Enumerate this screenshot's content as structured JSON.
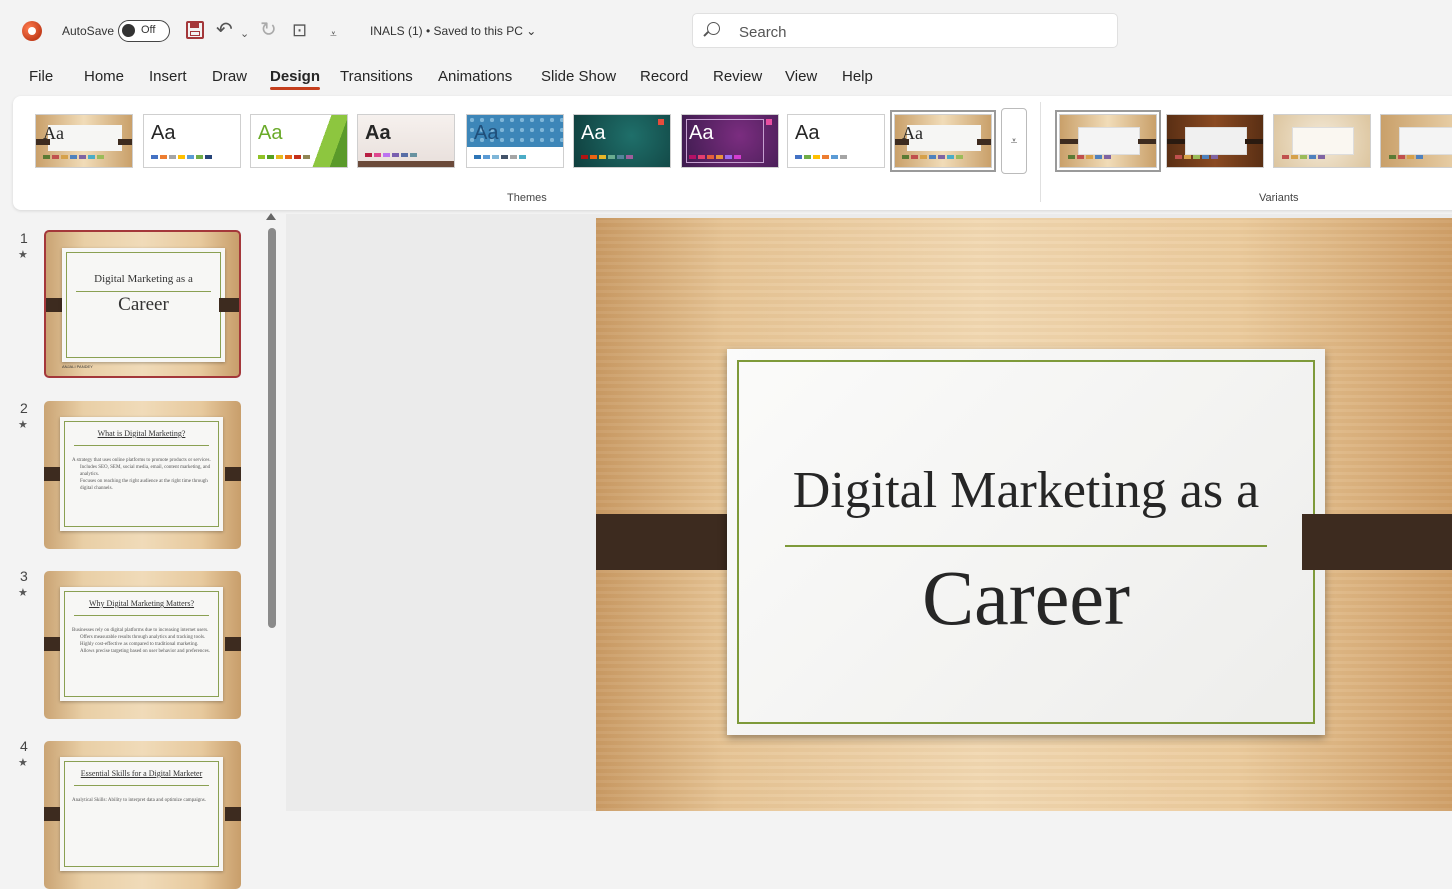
{
  "titlebar": {
    "autosave_label": "AutoSave",
    "autosave_state": "Off",
    "doc_title": "INALS (1) • Saved to this PC ⌄",
    "search_placeholder": "Search"
  },
  "menu": [
    "File",
    "Home",
    "Insert",
    "Draw",
    "Design",
    "Transitions",
    "Animations",
    "Slide Show",
    "Record",
    "Review",
    "View",
    "Help"
  ],
  "active_tab": "Design",
  "ribbon": {
    "themes_label": "Themes",
    "variants_label": "Variants",
    "theme_aa": "Aa"
  },
  "slides": [
    {
      "num": "1",
      "title": "Digital Marketing as a",
      "subtitle": "Career",
      "footer": "ANJALI PANDEY"
    },
    {
      "num": "2",
      "title": "What is Digital Marketing?",
      "bullets": [
        "A strategy that uses online platforms to promote products or services.",
        "Includes SEO, SEM, social media, email, content marketing, and analytics.",
        "Focuses on reaching the right audience at the right time through digital channels."
      ]
    },
    {
      "num": "3",
      "title": "Why Digital Marketing Matters?",
      "bullets": [
        "Businesses rely on digital platforms due to increasing internet users.",
        "Offers measurable results through analytics and tracking tools.",
        "Highly cost-effective as compared to traditional marketing.",
        "Allows precise targeting based on user behavior and preferences."
      ]
    },
    {
      "num": "4",
      "title": "Essential Skills for a Digital Marketer",
      "bullets": [
        "Analytical Skills: Ability to interpret data and optimize campaigns."
      ]
    }
  ],
  "main_slide": {
    "title": "Digital Marketing as a",
    "subtitle": "Career"
  },
  "colors": {
    "accent": "#c43e1c",
    "selected_border": "#a4373a",
    "frame_green": "#7e9a3a",
    "bar_brown": "#3d2b1f"
  }
}
